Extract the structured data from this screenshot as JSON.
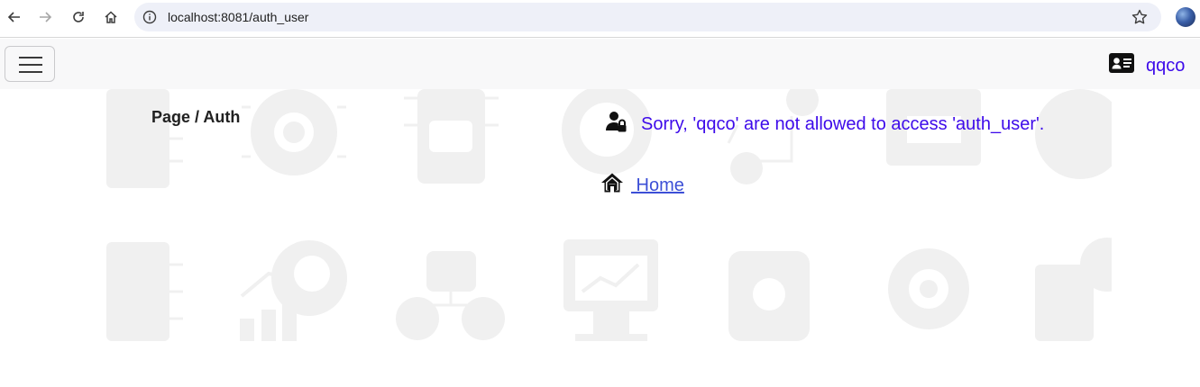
{
  "browser": {
    "url": "localhost:8081/auth_user",
    "icons": [
      "back-arrow-icon",
      "forward-arrow-icon",
      "reload-icon",
      "home-icon",
      "info-icon",
      "star-icon",
      "profile-avatar"
    ]
  },
  "navbar": {
    "menu_icon": "hamburger-icon",
    "user_icon": "id-card-icon",
    "user_name": "qqco"
  },
  "page": {
    "breadcrumb": "Page / Auth",
    "message": "Sorry, 'qqco' are not allowed to access 'auth_user'.",
    "home_link": " Home"
  },
  "colors": {
    "accent": "#3d0aea",
    "link": "#3c4fd6",
    "background_art": "#f0f0f0"
  }
}
